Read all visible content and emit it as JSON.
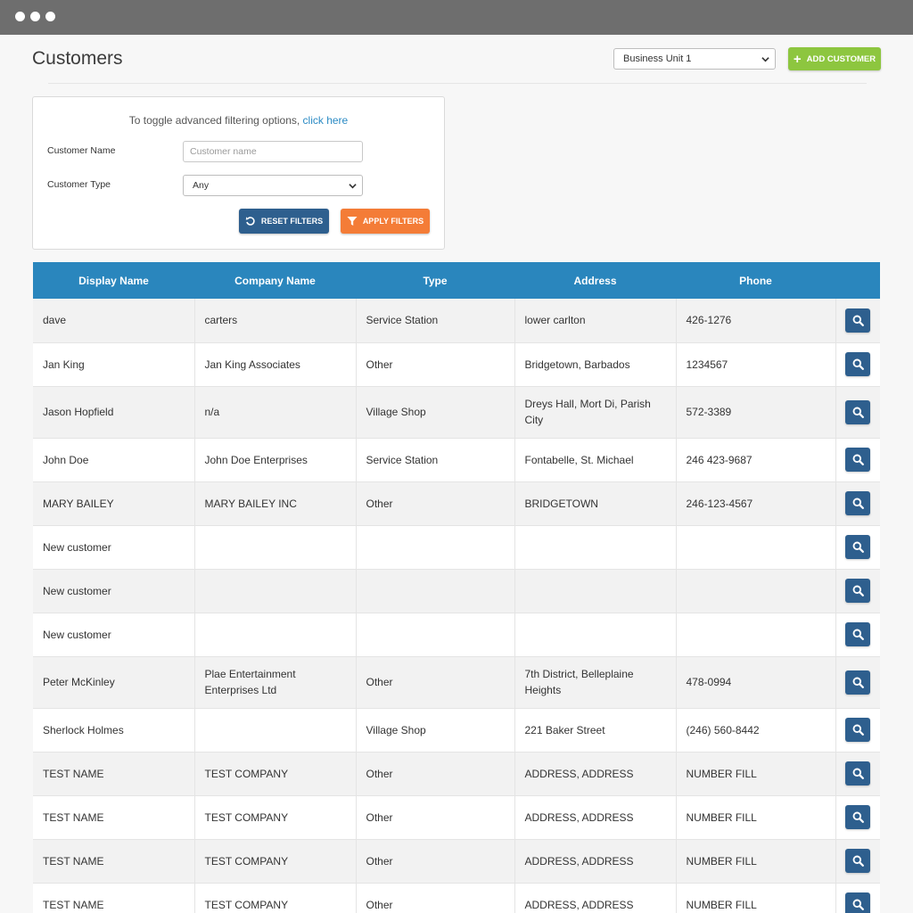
{
  "page": {
    "title": "Customers",
    "business_unit": "Business Unit 1",
    "add_label": "ADD CUSTOMER"
  },
  "filters": {
    "toggle_text": "To toggle advanced filtering options, ",
    "toggle_link": "click here",
    "customer_name_label": "Customer Name",
    "customer_name_placeholder": "Customer name",
    "customer_name_value": "",
    "customer_type_label": "Customer Type",
    "customer_type_value": "Any",
    "reset_label": "RESET FILTERS",
    "apply_label": "APPLY FILTERS"
  },
  "table": {
    "columns": [
      "Display Name",
      "Company Name",
      "Type",
      "Address",
      "Phone",
      ""
    ],
    "rows": [
      {
        "display_name": "dave",
        "company": "carters",
        "type": "Service Station",
        "address": "lower carlton",
        "phone": "426-1276"
      },
      {
        "display_name": "Jan King",
        "company": "Jan King Associates",
        "type": "Other",
        "address": "Bridgetown, Barbados",
        "phone": "1234567"
      },
      {
        "display_name": "Jason Hopfield",
        "company": "n/a",
        "type": "Village Shop",
        "address": "Dreys Hall, Mort Di, Parish City",
        "phone": "572-3389"
      },
      {
        "display_name": "John Doe",
        "company": "John Doe Enterprises",
        "type": "Service Station",
        "address": "Fontabelle, St. Michael",
        "phone": "246 423-9687"
      },
      {
        "display_name": "MARY BAILEY",
        "company": "MARY BAILEY INC",
        "type": "Other",
        "address": "BRIDGETOWN",
        "phone": "246-123-4567"
      },
      {
        "display_name": "New customer",
        "company": "",
        "type": "",
        "address": "",
        "phone": ""
      },
      {
        "display_name": "New customer",
        "company": "",
        "type": "",
        "address": "",
        "phone": ""
      },
      {
        "display_name": "New customer",
        "company": "",
        "type": "",
        "address": "",
        "phone": ""
      },
      {
        "display_name": "Peter McKinley",
        "company": "Plae Entertainment Enterprises Ltd",
        "type": "Other",
        "address": "7th District, Belleplaine Heights",
        "phone": "478-0994"
      },
      {
        "display_name": "Sherlock Holmes",
        "company": "",
        "type": "Village Shop",
        "address": "221 Baker Street",
        "phone": "(246) 560-8442"
      },
      {
        "display_name": "TEST NAME",
        "company": "TEST COMPANY",
        "type": "Other",
        "address": "ADDRESS, ADDRESS",
        "phone": "NUMBER FILL"
      },
      {
        "display_name": "TEST NAME",
        "company": "TEST COMPANY",
        "type": "Other",
        "address": "ADDRESS, ADDRESS",
        "phone": "NUMBER FILL"
      },
      {
        "display_name": "TEST NAME",
        "company": "TEST COMPANY",
        "type": "Other",
        "address": "ADDRESS, ADDRESS",
        "phone": "NUMBER FILL"
      },
      {
        "display_name": "TEST NAME",
        "company": "TEST COMPANY",
        "type": "Other",
        "address": "ADDRESS, ADDRESS",
        "phone": "NUMBER FILL"
      }
    ]
  },
  "icons": {
    "add": "plus-icon",
    "reset": "undo-icon",
    "apply": "filter-icon",
    "view": "search-icon",
    "dropdown": "chevron-down-icon"
  },
  "colors": {
    "header_bar": "#6e6e6e",
    "table_header": "#2a86bd",
    "add_button": "#8dc63f",
    "reset_button": "#2e5f8e",
    "apply_button": "#f47c37",
    "link": "#2a8ac4"
  }
}
